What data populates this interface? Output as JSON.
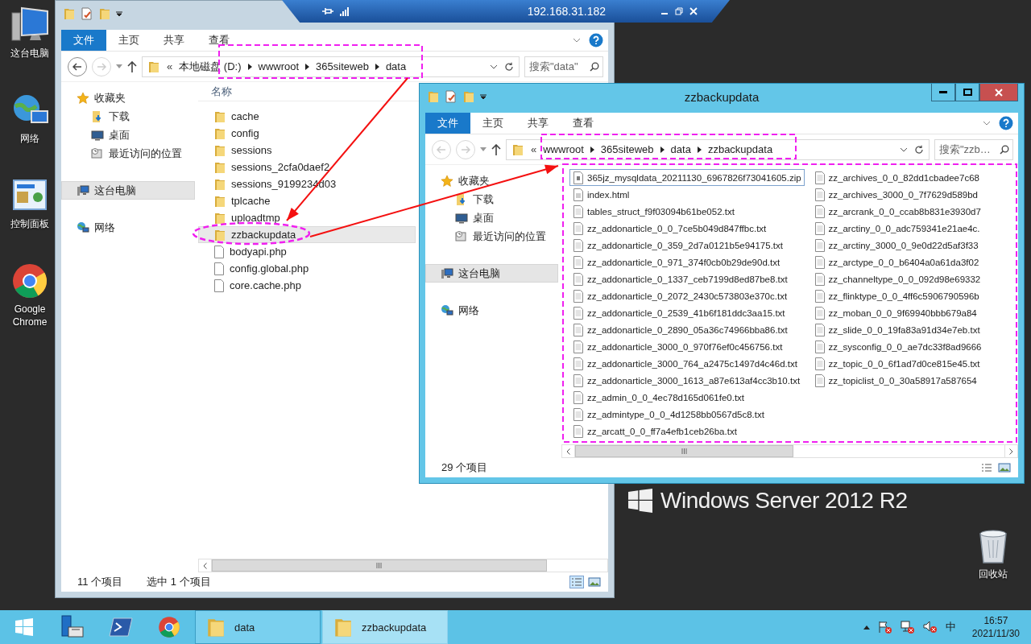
{
  "remote_bar": {
    "host": "192.168.31.182"
  },
  "desktop_icons": [
    {
      "kind": "computer",
      "label": "这台电脑"
    },
    {
      "kind": "network",
      "label": "网络"
    },
    {
      "kind": "control-panel",
      "label": "控制面板"
    },
    {
      "kind": "chrome",
      "label": "Google Chrome"
    }
  ],
  "recycle_bin": {
    "label": "回收站"
  },
  "brand": {
    "text": "Windows Server 2012 R2"
  },
  "windows": [
    {
      "active": false,
      "caption_buttons_visible": false,
      "ribbon_tabs": [
        {
          "label": "文件",
          "kind": "file-menu"
        },
        {
          "label": "主页",
          "kind": "tab"
        },
        {
          "label": "共享",
          "kind": "tab"
        },
        {
          "label": "查看",
          "kind": "tab"
        }
      ],
      "back_disabled": false,
      "forward_disabled": true,
      "address": {
        "overflow_mark": "«",
        "segments": [
          "本地磁盘 (D:)",
          "wwwroot",
          "365siteweb",
          "data"
        ]
      },
      "search": {
        "placeholder": "搜索\"data\""
      },
      "nav": [
        {
          "kind": "favorites",
          "label": "收藏夹",
          "selected": false,
          "children": [
            {
              "kind": "downloads",
              "label": "下载",
              "selected": false
            },
            {
              "kind": "desktop",
              "label": "桌面",
              "selected": false
            },
            {
              "kind": "recent",
              "label": "最近访问的位置",
              "selected": false
            }
          ]
        },
        {
          "kind": "computer",
          "label": "这台电脑",
          "selected": true
        },
        {
          "kind": "network",
          "label": "网络",
          "selected": false
        }
      ],
      "column_header": "名称",
      "files": [
        {
          "kind": "folder",
          "name": "cache",
          "selected": false,
          "focused": false
        },
        {
          "kind": "folder",
          "name": "config",
          "selected": false,
          "focused": false
        },
        {
          "kind": "folder",
          "name": "sessions",
          "selected": false,
          "focused": false
        },
        {
          "kind": "folder",
          "name": "sessions_2cfa0daef2",
          "selected": false,
          "focused": false
        },
        {
          "kind": "folder",
          "name": "sessions_9199234d03",
          "selected": false,
          "focused": false
        },
        {
          "kind": "folder",
          "name": "tplcache",
          "selected": false,
          "focused": false
        },
        {
          "kind": "folder",
          "name": "uploadtmp",
          "selected": false,
          "focused": false
        },
        {
          "kind": "folder",
          "name": "zzbackupdata",
          "selected": true,
          "focused": false
        },
        {
          "kind": "file",
          "name": "bodyapi.php",
          "selected": false,
          "focused": false
        },
        {
          "kind": "file",
          "name": "config.global.php",
          "selected": false,
          "focused": false
        },
        {
          "kind": "file",
          "name": "core.cache.php",
          "selected": false,
          "focused": false
        }
      ],
      "status": {
        "count": "11 个项目",
        "selection": "选中 1 个项目"
      }
    },
    {
      "active": true,
      "caption_buttons_visible": true,
      "title": "zzbackupdata",
      "ribbon_tabs": [
        {
          "label": "文件",
          "kind": "file-menu"
        },
        {
          "label": "主页",
          "kind": "tab"
        },
        {
          "label": "共享",
          "kind": "tab"
        },
        {
          "label": "查看",
          "kind": "tab"
        }
      ],
      "back_disabled": true,
      "forward_disabled": true,
      "address": {
        "overflow_mark": "«",
        "segments": [
          "wwwroot",
          "365siteweb",
          "data",
          "zzbackupdata"
        ]
      },
      "search": {
        "placeholder": "搜索\"zzb…"
      },
      "nav": [
        {
          "kind": "favorites",
          "label": "收藏夹",
          "selected": false,
          "children": [
            {
              "kind": "downloads",
              "label": "下载",
              "selected": false
            },
            {
              "kind": "desktop",
              "label": "桌面",
              "selected": false
            },
            {
              "kind": "recent",
              "label": "最近访问的位置",
              "selected": false
            }
          ]
        },
        {
          "kind": "computer",
          "label": "这台电脑",
          "selected": true
        },
        {
          "kind": "network",
          "label": "网络",
          "selected": false
        }
      ],
      "files": [
        {
          "kind": "zip",
          "name": "365jz_mysqldata_20211130_6967826f73041605.zip",
          "selected": false,
          "focused": true
        },
        {
          "kind": "html",
          "name": "index.html",
          "selected": false,
          "focused": false
        },
        {
          "kind": "text",
          "name": "tables_struct_f9f03094b61be052.txt",
          "selected": false,
          "focused": false
        },
        {
          "kind": "text",
          "name": "zz_addonarticle_0_0_7ce5b049d847ffbc.txt",
          "selected": false,
          "focused": false
        },
        {
          "kind": "text",
          "name": "zz_addonarticle_0_359_2d7a0121b5e94175.txt",
          "selected": false,
          "focused": false
        },
        {
          "kind": "text",
          "name": "zz_addonarticle_0_971_374f0cb0b29de90d.txt",
          "selected": false,
          "focused": false
        },
        {
          "kind": "text",
          "name": "zz_addonarticle_0_1337_ceb7199d8ed87be8.txt",
          "selected": false,
          "focused": false
        },
        {
          "kind": "text",
          "name": "zz_addonarticle_0_2072_2430c573803e370c.txt",
          "selected": false,
          "focused": false
        },
        {
          "kind": "text",
          "name": "zz_addonarticle_0_2539_41b6f181ddc3aa15.txt",
          "selected": false,
          "focused": false
        },
        {
          "kind": "text",
          "name": "zz_addonarticle_0_2890_05a36c74966bba86.txt",
          "selected": false,
          "focused": false
        },
        {
          "kind": "text",
          "name": "zz_addonarticle_3000_0_970f76ef0c456756.txt",
          "selected": false,
          "focused": false
        },
        {
          "kind": "text",
          "name": "zz_addonarticle_3000_764_a2475c1497d4c46d.txt",
          "selected": false,
          "focused": false
        },
        {
          "kind": "text",
          "name": "zz_addonarticle_3000_1613_a87e613af4cc3b10.txt",
          "selected": false,
          "focused": false
        },
        {
          "kind": "text",
          "name": "zz_admin_0_0_4ec78d165d061fe0.txt",
          "selected": false,
          "focused": false
        },
        {
          "kind": "text",
          "name": "zz_admintype_0_0_4d1258bb0567d5c8.txt",
          "selected": false,
          "focused": false
        },
        {
          "kind": "text",
          "name": "zz_arcatt_0_0_ff7a4efb1ceb26ba.txt",
          "selected": false,
          "focused": false
        },
        {
          "kind": "text",
          "name": "zz_archives_0_0_82dd1cbadee7c68",
          "selected": false,
          "focused": false
        },
        {
          "kind": "text",
          "name": "zz_archives_3000_0_7f7629d589bd",
          "selected": false,
          "focused": false
        },
        {
          "kind": "text",
          "name": "zz_arcrank_0_0_ccab8b831e3930d7",
          "selected": false,
          "focused": false
        },
        {
          "kind": "text",
          "name": "zz_arctiny_0_0_adc759341e21ae4c.",
          "selected": false,
          "focused": false
        },
        {
          "kind": "text",
          "name": "zz_arctiny_3000_0_9e0d22d5af3f33",
          "selected": false,
          "focused": false
        },
        {
          "kind": "text",
          "name": "zz_arctype_0_0_b6404a0a61da3f02",
          "selected": false,
          "focused": false
        },
        {
          "kind": "text",
          "name": "zz_channeltype_0_0_092d98e69332",
          "selected": false,
          "focused": false
        },
        {
          "kind": "text",
          "name": "zz_flinktype_0_0_4ff6c5906790596b",
          "selected": false,
          "focused": false
        },
        {
          "kind": "text",
          "name": "zz_moban_0_0_9f69940bbb679a84",
          "selected": false,
          "focused": false
        },
        {
          "kind": "text",
          "name": "zz_slide_0_0_19fa83a91d34e7eb.txt",
          "selected": false,
          "focused": false
        },
        {
          "kind": "text",
          "name": "zz_sysconfig_0_0_ae7dc33f8ad9666",
          "selected": false,
          "focused": false
        },
        {
          "kind": "text",
          "name": "zz_topic_0_0_6f1ad7d0ce815e45.txt",
          "selected": false,
          "focused": false
        },
        {
          "kind": "text",
          "name": "zz_topiclist_0_0_30a58917a587654",
          "selected": false,
          "focused": false
        }
      ],
      "status": {
        "count": "29 个项目"
      }
    }
  ],
  "annotations": [
    {
      "kind": "dashed-box"
    },
    {
      "kind": "arrow"
    },
    {
      "kind": "dashed-ellipse"
    },
    {
      "kind": "arrow"
    },
    {
      "kind": "dashed-box"
    },
    {
      "kind": "dashed-box"
    }
  ],
  "taskbar": {
    "pinned": [
      {
        "kind": "start"
      },
      {
        "kind": "server-manager"
      },
      {
        "kind": "powershell"
      },
      {
        "kind": "chrome"
      }
    ],
    "buttons": [
      {
        "label": "data",
        "active": false
      },
      {
        "label": "zzbackupdata",
        "active": true
      }
    ],
    "tray": {
      "ime": "中",
      "time": "16:57",
      "date": "2021/11/30"
    }
  }
}
